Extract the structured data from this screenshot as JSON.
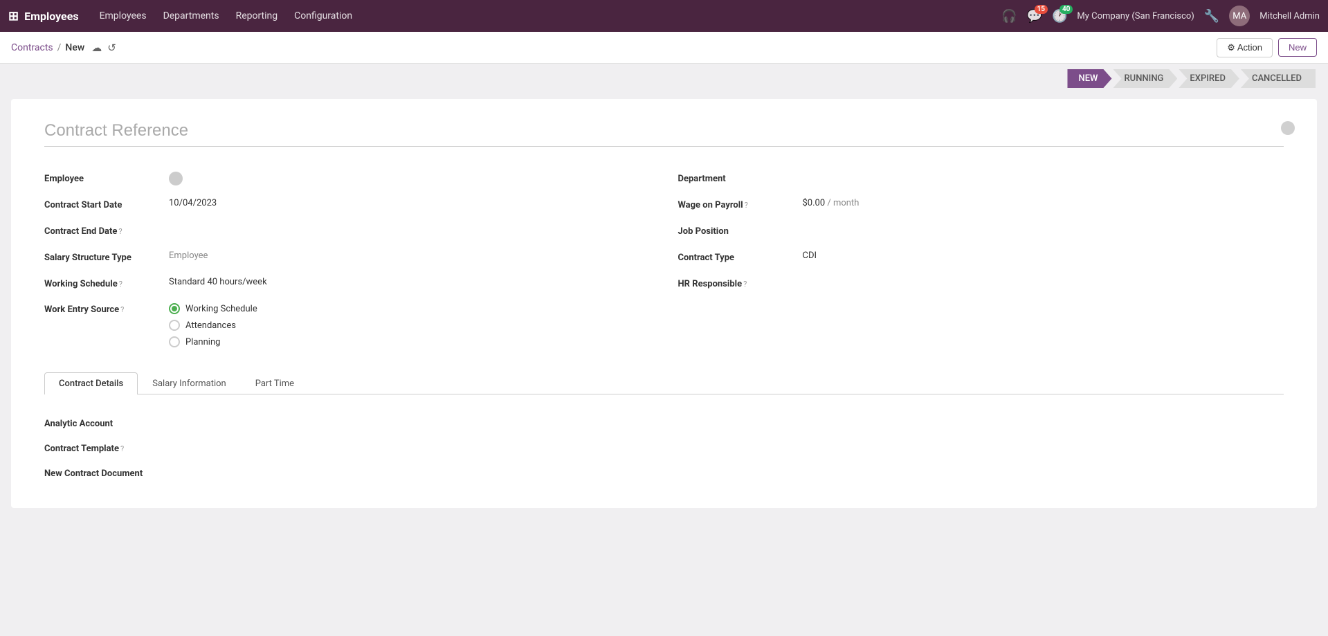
{
  "app": {
    "name": "Employees",
    "grid_icon": "⊞"
  },
  "topnav": {
    "menu_items": [
      {
        "label": "Employees",
        "active": true
      },
      {
        "label": "Departments"
      },
      {
        "label": "Reporting"
      },
      {
        "label": "Configuration"
      }
    ],
    "notifications": {
      "chat_count": "15",
      "activity_count": "40"
    },
    "company": "My Company (San Francisco)",
    "username": "Mitchell Admin"
  },
  "breadcrumb": {
    "parent": "Contracts",
    "separator": "/",
    "current": "New"
  },
  "toolbar": {
    "action_label": "⚙ Action",
    "new_label": "New"
  },
  "status_steps": [
    {
      "label": "NEW",
      "active": true
    },
    {
      "label": "RUNNING",
      "active": false
    },
    {
      "label": "EXPIRED",
      "active": false
    },
    {
      "label": "CANCELLED",
      "active": false
    }
  ],
  "form": {
    "contract_reference_placeholder": "Contract Reference",
    "fields_left": [
      {
        "label": "Employee",
        "value": "",
        "type": "employee_dot"
      },
      {
        "label": "Contract Start Date",
        "value": "10/04/2023",
        "type": "text"
      },
      {
        "label": "Contract End Date",
        "help": "?",
        "value": "",
        "type": "text"
      },
      {
        "label": "Salary Structure Type",
        "value": "Employee",
        "type": "text"
      },
      {
        "label": "Working Schedule",
        "help": "?",
        "value": "Standard 40 hours/week",
        "type": "text"
      },
      {
        "label": "Work Entry Source",
        "help": "?",
        "value": "",
        "type": "radio"
      }
    ],
    "fields_right": [
      {
        "label": "Department",
        "value": "",
        "type": "text"
      },
      {
        "label": "Wage on Payroll",
        "help": "?",
        "value": "$0.00",
        "suffix": "/ month",
        "type": "wage"
      },
      {
        "label": "Job Position",
        "value": "",
        "type": "text"
      },
      {
        "label": "Contract Type",
        "value": "CDI",
        "type": "text"
      },
      {
        "label": "HR Responsible",
        "help": "?",
        "value": "",
        "type": "text"
      }
    ],
    "radio_options": [
      {
        "label": "Working Schedule",
        "checked": true
      },
      {
        "label": "Attendances",
        "checked": false
      },
      {
        "label": "Planning",
        "checked": false
      }
    ],
    "tabs": [
      {
        "label": "Contract Details",
        "active": true
      },
      {
        "label": "Salary Information",
        "active": false
      },
      {
        "label": "Part Time",
        "active": false
      }
    ],
    "tab_fields": [
      {
        "label": "Analytic Account",
        "value": ""
      },
      {
        "label": "Contract Template",
        "help": "?",
        "value": ""
      },
      {
        "label": "New Contract Document",
        "value": ""
      }
    ]
  }
}
